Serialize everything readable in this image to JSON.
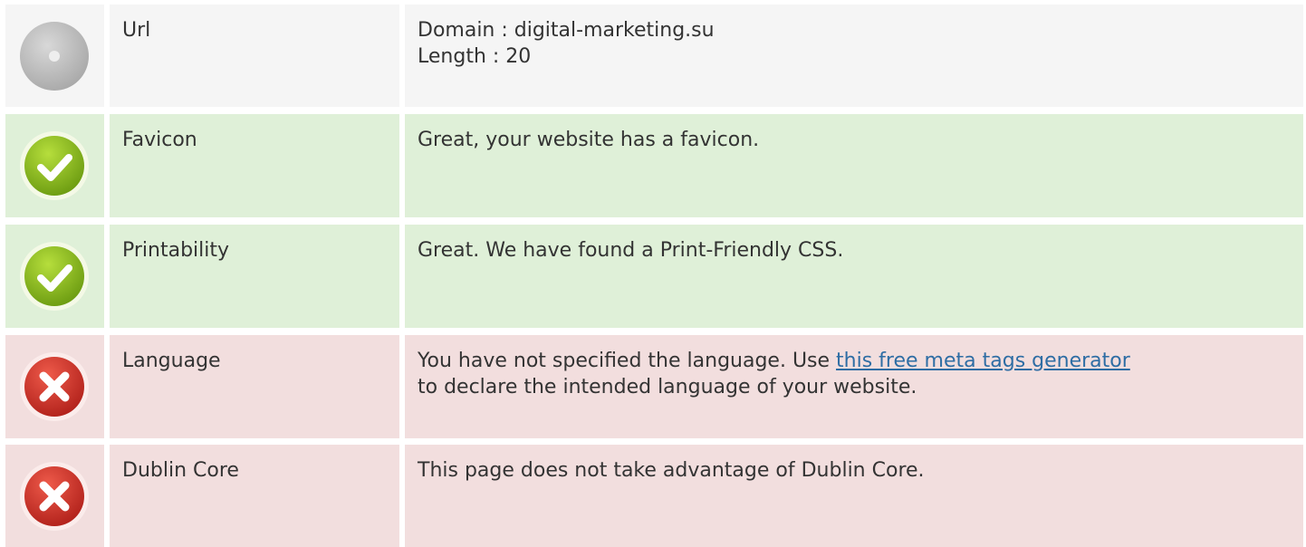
{
  "colors": {
    "neutral_bg": "#f5f5f5",
    "success_bg": "#dff0d8",
    "error_bg": "#f2dede",
    "link": "#2e6da4",
    "text": "#333333"
  },
  "rows": [
    {
      "status": "neutral",
      "icon": "neutral-circle-icon",
      "label": "Url",
      "lines": [
        "Domain : digital-marketing.su",
        "Length : 20"
      ]
    },
    {
      "status": "success",
      "icon": "check-circle-icon",
      "label": "Favicon",
      "text": "Great, your website has a favicon."
    },
    {
      "status": "success",
      "icon": "check-circle-icon",
      "label": "Printability",
      "text": "Great. We have found a Print-Friendly CSS."
    },
    {
      "status": "error",
      "icon": "error-x-icon",
      "label": "Language",
      "text_before": "You have not specified the language. Use ",
      "link_text": "this free meta tags generator",
      "text_after": "to declare the intended language of your website."
    },
    {
      "status": "error",
      "icon": "error-x-icon",
      "label": "Dublin Core",
      "text": "This page does not take advantage of Dublin Core."
    }
  ]
}
